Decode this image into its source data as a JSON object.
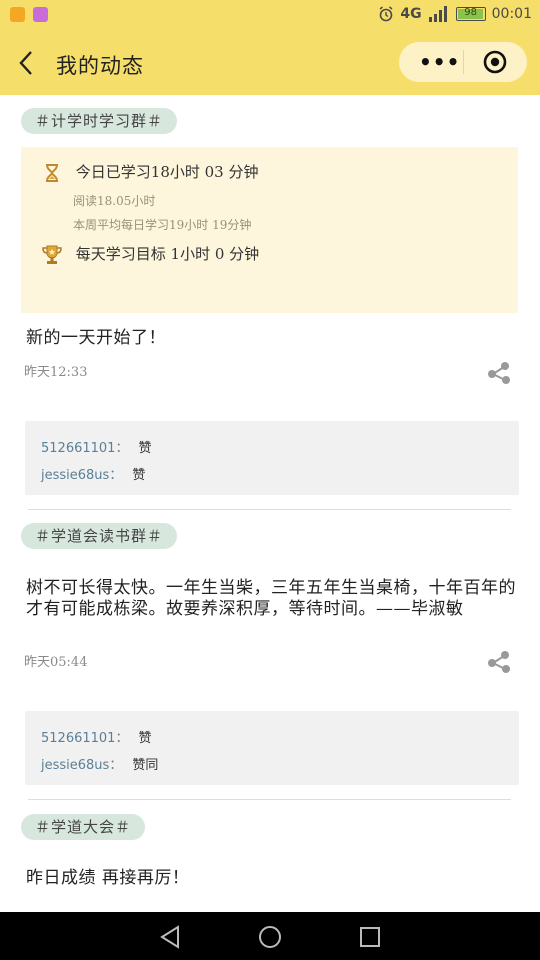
{
  "status_bar": {
    "network": "4G",
    "battery": "98",
    "time": "00:01"
  },
  "header": {
    "title": "我的动态",
    "more_icon": "more-dots-icon",
    "close_icon": "target-icon",
    "bg_color": "#f6de6b"
  },
  "posts": [
    {
      "group_tag": "＃计学时学习群＃",
      "stats": {
        "today": "今日已学习18小时 03 分钟",
        "reading": "阅读18.05小时",
        "weekly_avg": "本周平均每日学习19小时 19分钟",
        "goal": "每天学习目标 1小时 0 分钟"
      },
      "text": "新的一天开始了！",
      "time": "昨天12:33",
      "comments": [
        {
          "user": "512661101：",
          "text": "赞"
        },
        {
          "user": "jessie68us：",
          "text": "赞"
        }
      ]
    },
    {
      "group_tag": "＃学道会读书群＃",
      "text": "树不可长得太快。一年生当柴，三年五年生当桌椅，十年百年的才有可能成栋梁。故要养深积厚，等待时间。——毕淑敏",
      "time": "昨天05:44",
      "comments": [
        {
          "user": "512661101：",
          "text": "赞"
        },
        {
          "user": "jessie68us：",
          "text": "赞同"
        }
      ]
    },
    {
      "group_tag": "＃学道大会＃",
      "text": "昨日成绩 再接再厉！"
    }
  ]
}
